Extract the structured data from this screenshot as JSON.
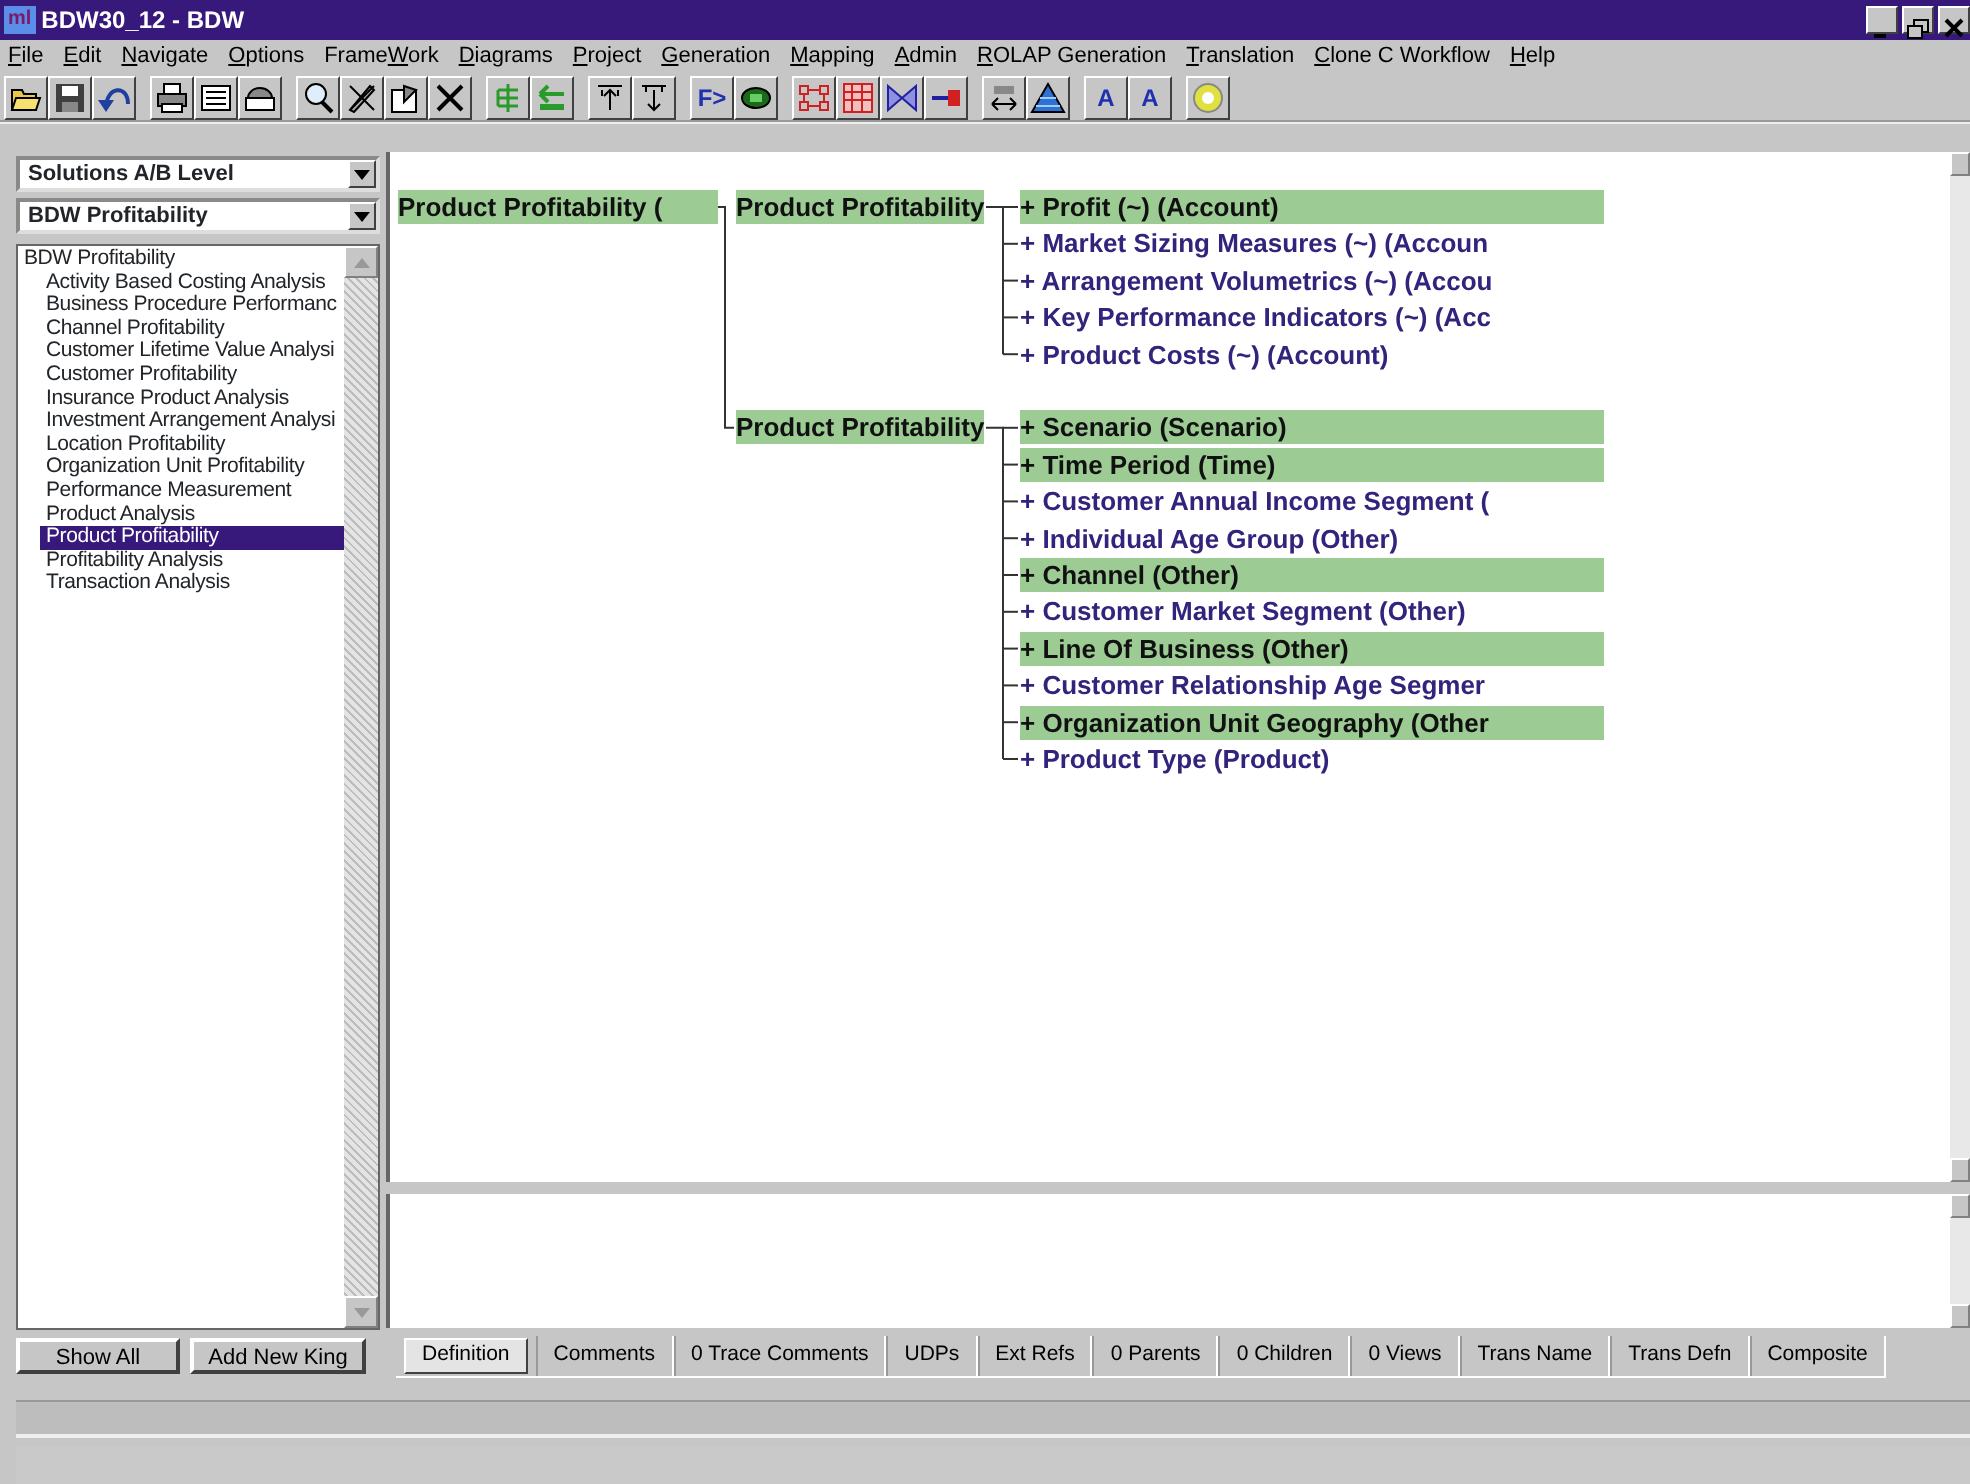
{
  "window": {
    "icon_label": "ml",
    "title": "BDW30_12 -  BDW"
  },
  "menu": [
    {
      "parts": [
        {
          "text": "F",
          "underlined": true
        },
        {
          "text": "ile",
          "underlined": false
        }
      ]
    },
    {
      "parts": [
        {
          "text": "E",
          "underlined": true
        },
        {
          "text": "dit",
          "underlined": false
        }
      ]
    },
    {
      "parts": [
        {
          "text": "N",
          "underlined": true
        },
        {
          "text": "avigate",
          "underlined": false
        }
      ]
    },
    {
      "parts": [
        {
          "text": "O",
          "underlined": true
        },
        {
          "text": "ptions",
          "underlined": false
        }
      ]
    },
    {
      "parts": [
        {
          "text": "Frame",
          "underlined": false
        },
        {
          "text": "W",
          "underlined": true
        },
        {
          "text": "ork",
          "underlined": false
        }
      ]
    },
    {
      "parts": [
        {
          "text": "D",
          "underlined": true
        },
        {
          "text": "iagrams",
          "underlined": false
        }
      ]
    },
    {
      "parts": [
        {
          "text": "P",
          "underlined": true
        },
        {
          "text": "roject",
          "underlined": false
        }
      ]
    },
    {
      "parts": [
        {
          "text": "G",
          "underlined": true
        },
        {
          "text": "eneration",
          "underlined": false
        }
      ]
    },
    {
      "parts": [
        {
          "text": "M",
          "underlined": true
        },
        {
          "text": "apping",
          "underlined": false
        }
      ]
    },
    {
      "parts": [
        {
          "text": "A",
          "underlined": true
        },
        {
          "text": "dmin",
          "underlined": false
        }
      ]
    },
    {
      "parts": [
        {
          "text": "R",
          "underlined": true
        },
        {
          "text": "OLAP Generation",
          "underlined": false
        }
      ]
    },
    {
      "parts": [
        {
          "text": "T",
          "underlined": true
        },
        {
          "text": "ranslation",
          "underlined": false
        }
      ]
    },
    {
      "parts": [
        {
          "text": "C",
          "underlined": true
        },
        {
          "text": "lone C Workflow",
          "underlined": false
        }
      ]
    },
    {
      "parts": [
        {
          "text": "H",
          "underlined": true
        },
        {
          "text": "elp",
          "underlined": false
        }
      ]
    }
  ],
  "toolbar": [
    [
      {
        "kind": "open"
      },
      {
        "kind": "save"
      },
      {
        "kind": "undo"
      }
    ],
    [
      {
        "kind": "print"
      },
      {
        "kind": "form"
      },
      {
        "kind": "kit"
      }
    ],
    [
      {
        "kind": "search"
      },
      {
        "kind": "erase"
      },
      {
        "kind": "properties"
      },
      {
        "kind": "delete"
      }
    ],
    [
      {
        "kind": "tree"
      },
      {
        "kind": "back"
      }
    ],
    [
      {
        "kind": "top"
      },
      {
        "kind": "bottom"
      }
    ],
    [
      {
        "kind": "text",
        "label": "F>"
      },
      {
        "kind": "disc"
      }
    ],
    [
      {
        "kind": "network"
      },
      {
        "kind": "grid"
      },
      {
        "kind": "bowtie"
      },
      {
        "kind": "arrow"
      }
    ],
    [
      {
        "kind": "swap"
      },
      {
        "kind": "pyramid"
      }
    ],
    [
      {
        "kind": "text",
        "label": "A"
      },
      {
        "kind": "text",
        "label": "A"
      }
    ],
    [
      {
        "kind": "help"
      }
    ]
  ],
  "sidebar": {
    "level_combo": "Solutions A/B Level",
    "model_combo": "BDW Profitability",
    "items": [
      {
        "label": "BDW Profitability",
        "selected": false,
        "children": [
          {
            "label": "Activity Based Costing Analysis",
            "selected": false
          },
          {
            "label": "Business Procedure Performanc",
            "selected": false
          },
          {
            "label": "Channel Profitability",
            "selected": false
          },
          {
            "label": "Customer Lifetime Value Analysi",
            "selected": false
          },
          {
            "label": "Customer Profitability",
            "selected": false
          },
          {
            "label": "Insurance Product Analysis",
            "selected": false
          },
          {
            "label": "Investment Arrangement Analysi",
            "selected": false
          },
          {
            "label": "Location Profitability",
            "selected": false
          },
          {
            "label": "Organization Unit Profitability",
            "selected": false
          },
          {
            "label": "Performance Measurement",
            "selected": false
          },
          {
            "label": "Product Analysis",
            "selected": false
          },
          {
            "label": "Product Profitability",
            "selected": true
          },
          {
            "label": "Profitability Analysis",
            "selected": false
          },
          {
            "label": "Transaction Analysis",
            "selected": false
          }
        ]
      }
    ],
    "buttons": [
      "Show All",
      "Add New King"
    ]
  },
  "diagram": {
    "root": "Product Profitability (",
    "groups": [
      {
        "label": "Product Profitability",
        "leaves": [
          {
            "label": "+ Profit (~) (Account)",
            "highlighted": true
          },
          {
            "label": "+ Market Sizing Measures (~) (Accoun",
            "highlighted": false
          },
          {
            "label": "+ Arrangement Volumetrics (~) (Accou",
            "highlighted": false
          },
          {
            "label": "+ Key Performance Indicators (~) (Acc",
            "highlighted": false
          },
          {
            "label": "+ Product Costs (~) (Account)",
            "highlighted": false
          }
        ]
      },
      {
        "label": "Product Profitability",
        "leaves": [
          {
            "label": "+ Scenario (Scenario)",
            "highlighted": true
          },
          {
            "label": "+ Time Period (Time)",
            "highlighted": true
          },
          {
            "label": "+ Customer Annual Income Segment (",
            "highlighted": false
          },
          {
            "label": "+ Individual Age Group (Other)",
            "highlighted": false
          },
          {
            "label": "+ Channel (Other)",
            "highlighted": true
          },
          {
            "label": "+ Customer Market Segment (Other)",
            "highlighted": false
          },
          {
            "label": "+ Line Of Business (Other)",
            "highlighted": true
          },
          {
            "label": "+ Customer Relationship Age Segmer",
            "highlighted": false
          },
          {
            "label": "+ Organization Unit Geography (Other",
            "highlighted": true
          },
          {
            "label": "+ Product Type (Product)",
            "highlighted": false
          }
        ]
      }
    ]
  },
  "tabs": [
    {
      "label": "Definition",
      "selected": true
    },
    {
      "label": "Comments",
      "selected": false
    },
    {
      "label": "0 Trace Comments",
      "selected": false
    },
    {
      "label": "UDPs",
      "selected": false
    },
    {
      "label": "Ext Refs",
      "selected": false
    },
    {
      "label": "0 Parents",
      "selected": false
    },
    {
      "label": "0 Children",
      "selected": false
    },
    {
      "label": "0 Views",
      "selected": false
    },
    {
      "label": "Trans Name",
      "selected": false
    },
    {
      "label": "Trans Defn",
      "selected": false
    },
    {
      "label": "Composite",
      "selected": false
    }
  ]
}
